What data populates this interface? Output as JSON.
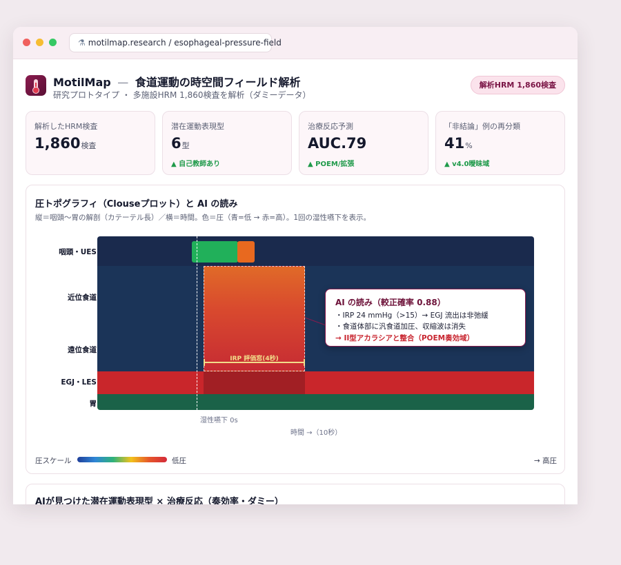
{
  "browser": {
    "url": "motilmap.research / esophageal-pressure-field"
  },
  "header": {
    "brand": "MotilMap",
    "separator": "—",
    "title": "食道運動の時空間フィールド解析",
    "subtitle": "研究プロトタイプ ・ 多施設HRM 1,860検査を解析（ダミーデータ）",
    "badge": "解析HRM 1,860検査"
  },
  "kpis": [
    {
      "label": "解析したHRM検査",
      "value": "1,860",
      "unit": "検査",
      "delta": ""
    },
    {
      "label": "潜在運動表現型",
      "value": "6",
      "unit": "型",
      "delta": "▲ 自己教師あり"
    },
    {
      "label": "治療反応予測",
      "value": "AUC.79",
      "unit": "",
      "delta": "▲ POEM/拡張"
    },
    {
      "label": "「非結論」例の再分類",
      "value": "41",
      "unit": "%",
      "delta": "▲ v4.0曖昧域"
    }
  ],
  "topo": {
    "title": "圧トポグラフィ（Clouseプロット）と AI の読み",
    "description": "縦＝咽頭〜胃の解剖（カテーテル長）／横＝時間。色＝圧（青=低 → 赤=高）。1回の湿性嚥下を表示。",
    "rows": [
      "咽頭・UES",
      "近位食道",
      "遠位食道",
      "EGJ・LES",
      "胃"
    ],
    "irp_window_label": "IRP 評価窓(4秒)",
    "swallow_label": "湿性嚥下 0s",
    "time_label": "時間 →（10秒）",
    "ai_read": {
      "title": "AI の読み（較正確率 0.88）",
      "lines": [
        "・IRP 24 mmHg（>15）→ EGJ 流出は非弛緩",
        "・食道体部に汎食道加圧、収縮波は消失"
      ],
      "conclusion": "→ II型アカラシアと整合（POEM奏効域）"
    },
    "legend": {
      "label": "圧スケール",
      "low": "低圧",
      "high": "→ 高圧"
    }
  },
  "section2": {
    "title": "AIが見つけた潜在運動表現型 × 治療反応（奏効率・ダミー）"
  }
}
